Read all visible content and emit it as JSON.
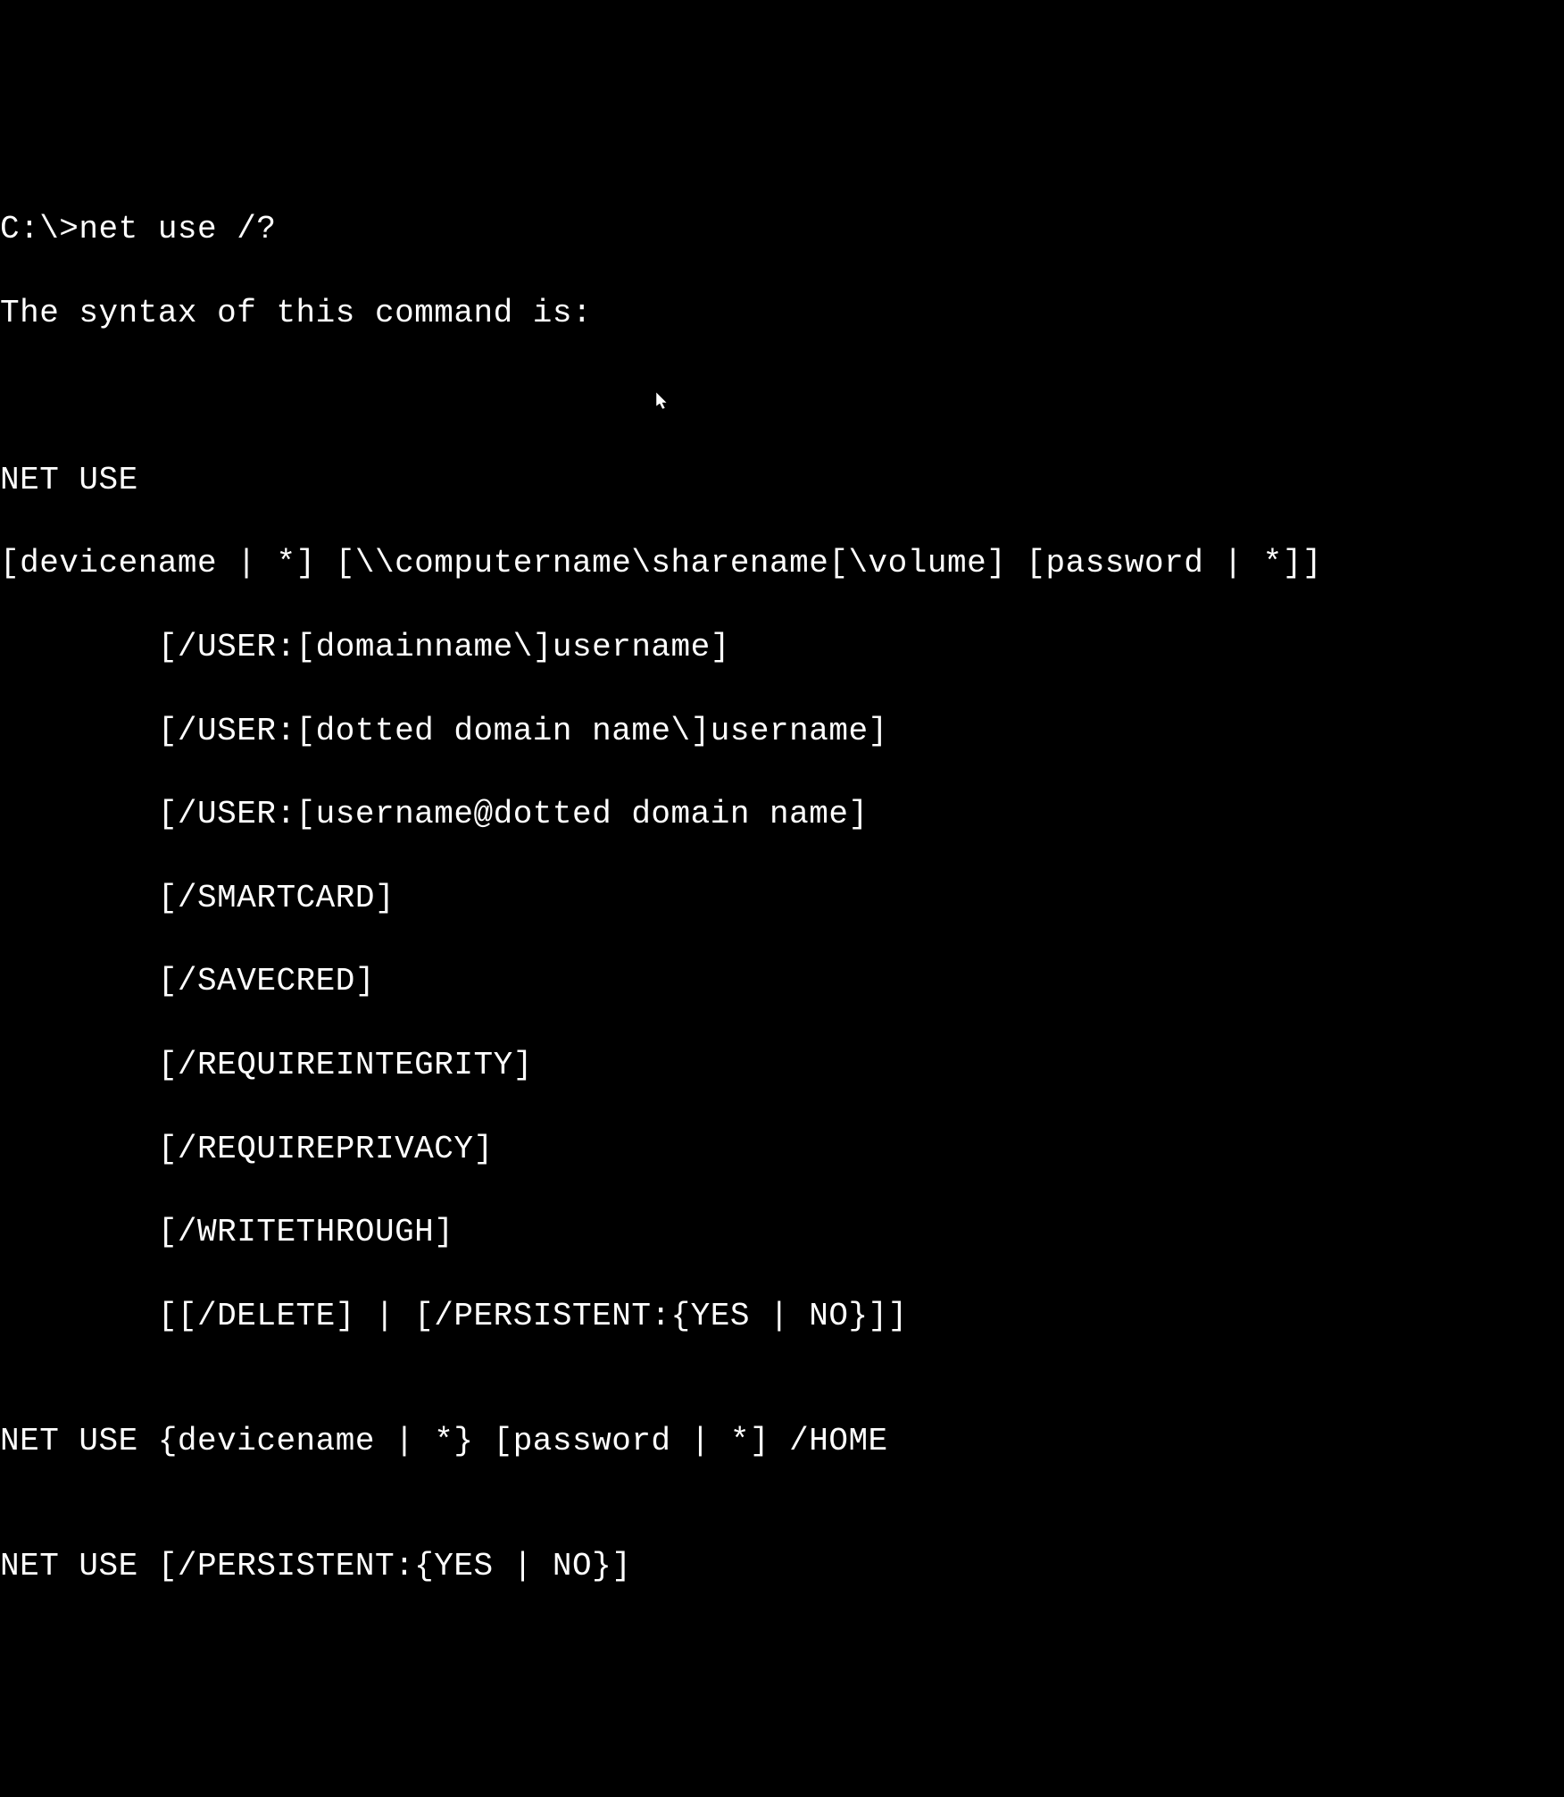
{
  "terminal": {
    "prompt": "C:\\>",
    "command": "net use /?",
    "lines": [
      "C:\\>net use /?",
      "The syntax of this command is:",
      "",
      "",
      "NET USE",
      "[devicename | *] [\\\\computername\\sharename[\\volume] [password | *]]",
      "        [/USER:[domainname\\]username]",
      "        [/USER:[dotted domain name\\]username]",
      "        [/USER:[username@dotted domain name]",
      "        [/SMARTCARD]",
      "        [/SAVECRED]",
      "        [/REQUIREINTEGRITY]",
      "        [/REQUIREPRIVACY]",
      "        [/WRITETHROUGH]",
      "        [[/DELETE] | [/PERSISTENT:{YES | NO}]]",
      "",
      "NET USE {devicename | *} [password | *] /HOME",
      "",
      "NET USE [/PERSISTENT:{YES | NO}]"
    ]
  }
}
